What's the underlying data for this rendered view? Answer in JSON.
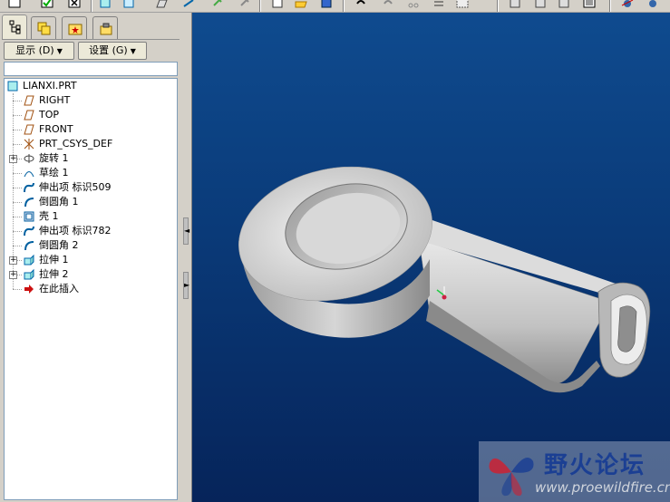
{
  "toolbar": {
    "buttons": [
      "new-icon",
      "save-icon",
      "close-icon",
      "view-icon",
      "datum-icon",
      "sketch-icon",
      "plane-icon",
      "axis-icon",
      "open-icon",
      "folder-icon",
      "save2-icon",
      "undo-icon",
      "redo-icon",
      "cut-icon",
      "list-icon",
      "window-icon",
      "model-icon",
      "copy-icon",
      "paste-icon",
      "shade-icon",
      "orient-icon",
      "view2-icon"
    ]
  },
  "model_tree": {
    "tabs": [
      "model-tree-tab",
      "layers-tab",
      "favorites-tab",
      "tools-tab"
    ],
    "show_label": "显示 (D)",
    "settings_label": "设置 (G)",
    "filter_value": "",
    "root": "LIANXI.PRT",
    "items": [
      {
        "label": "RIGHT",
        "icon": "datum-plane-icon",
        "expandable": false
      },
      {
        "label": "TOP",
        "icon": "datum-plane-icon",
        "expandable": false
      },
      {
        "label": "FRONT",
        "icon": "datum-plane-icon",
        "expandable": false
      },
      {
        "label": "PRT_CSYS_DEF",
        "icon": "csys-icon",
        "expandable": false
      },
      {
        "label": "旋转 1",
        "icon": "revolve-icon",
        "expandable": true
      },
      {
        "label": "草绘 1",
        "icon": "sketch-icon",
        "expandable": false
      },
      {
        "label": "伸出项 标识509",
        "icon": "protrusion-icon",
        "expandable": false
      },
      {
        "label": "倒圆角 1",
        "icon": "round-icon",
        "expandable": false
      },
      {
        "label": "壳 1",
        "icon": "shell-icon",
        "expandable": false
      },
      {
        "label": "伸出项 标识782",
        "icon": "protrusion-icon",
        "expandable": false
      },
      {
        "label": "倒圆角 2",
        "icon": "round-icon",
        "expandable": false
      },
      {
        "label": "拉伸 1",
        "icon": "extrude-icon",
        "expandable": true
      },
      {
        "label": "拉伸 2",
        "icon": "extrude-icon",
        "expandable": true
      },
      {
        "label": "在此插入",
        "icon": "insert-arrow-icon",
        "expandable": false
      }
    ]
  },
  "watermark": {
    "title": "野火论坛",
    "url": "www.proewildfire.cn"
  },
  "colors": {
    "viewport_top": "#0f4b8f",
    "viewport_bottom": "#06245a",
    "part_gray": "#c8c8c8"
  }
}
